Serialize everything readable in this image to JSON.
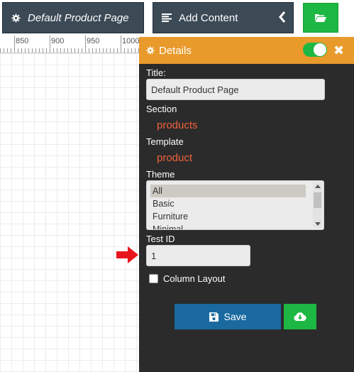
{
  "toolbar": {
    "page_button_label": "Default Product Page",
    "add_content_label": "Add Content"
  },
  "ruler": {
    "ticks": [
      "850",
      "900",
      "950",
      "1000"
    ]
  },
  "panel": {
    "header_title": "Details",
    "toggle_on": true,
    "title_label": "Title:",
    "title_value": "Default Product Page",
    "section_label": "Section",
    "section_value": "products",
    "template_label": "Template",
    "template_value": "product",
    "theme_label": "Theme",
    "theme_options": [
      "All",
      "Basic",
      "Furniture",
      "Minimal"
    ],
    "theme_selected": "All",
    "test_id_label": "Test ID",
    "test_id_value": "1",
    "column_layout_label": "Column Layout",
    "column_layout_checked": false,
    "save_label": "Save"
  },
  "colors": {
    "toolbar_button_bg": "#3c4a56",
    "panel_header_bg": "#e89a2b",
    "panel_bg": "#2b2b2b",
    "accent_green": "#1db843",
    "save_blue": "#1a6aa0",
    "value_red": "#f0623c",
    "annotation_arrow_red": "#e8141c"
  },
  "icons": {
    "page_button": "gear-icon",
    "add_content": "list-icon",
    "collapse": "chevron-left-icon",
    "open": "folder-open-icon",
    "panel_header": "gear-icon",
    "close": "close-icon",
    "save": "floppy-disk-icon",
    "download": "cloud-download-icon",
    "annotation": "red-arrow-icon"
  }
}
